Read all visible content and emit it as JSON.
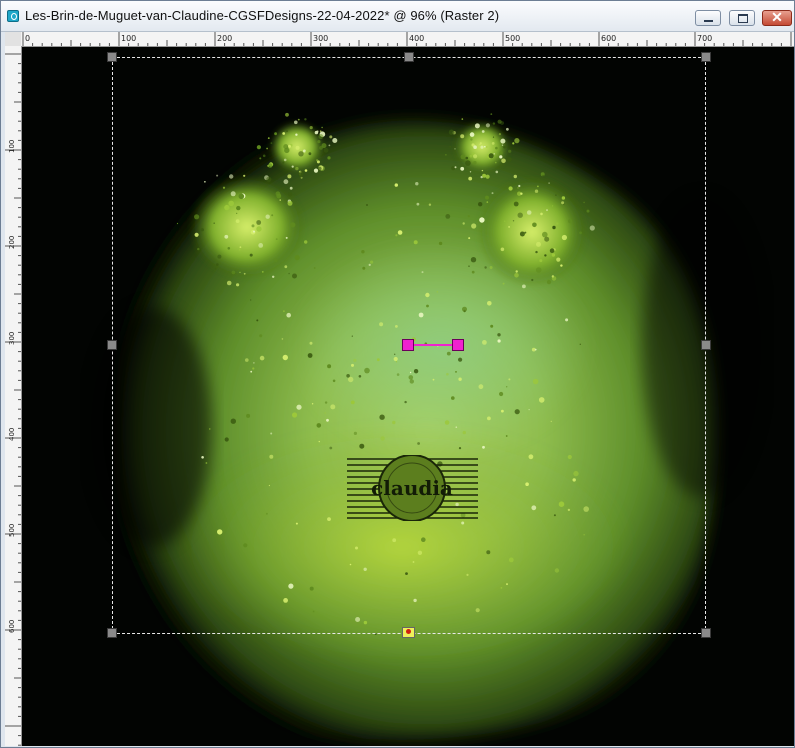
{
  "window": {
    "title": "Les-Brin-de-Muguet-van-Claudine-CGSFDesigns-22-04-2022* @  96% (Raster 2)",
    "icon": "paintshop-pro-app-icon",
    "controls": {
      "minimize_icon": "minimize-icon",
      "maximize_icon": "maximize-icon",
      "close_glyph": "✕"
    }
  },
  "rulers": {
    "horizontal_labels": [
      "0",
      "100",
      "200",
      "300",
      "400",
      "500",
      "600",
      "700"
    ],
    "vertical_labels": [
      "100",
      "200",
      "300",
      "400",
      "500",
      "600"
    ]
  },
  "canvas": {
    "background": "#020402",
    "artwork_colors": [
      "#9ccc54",
      "#7aa62c",
      "#5c8a2a",
      "#4a7a2e",
      "#2f4c12"
    ],
    "watermark_text": "claudia",
    "selection_tool": {
      "handle_color": "#8a8a8a",
      "pivot_color": "#f022d0",
      "center_marker_color": "#eef05a"
    }
  }
}
